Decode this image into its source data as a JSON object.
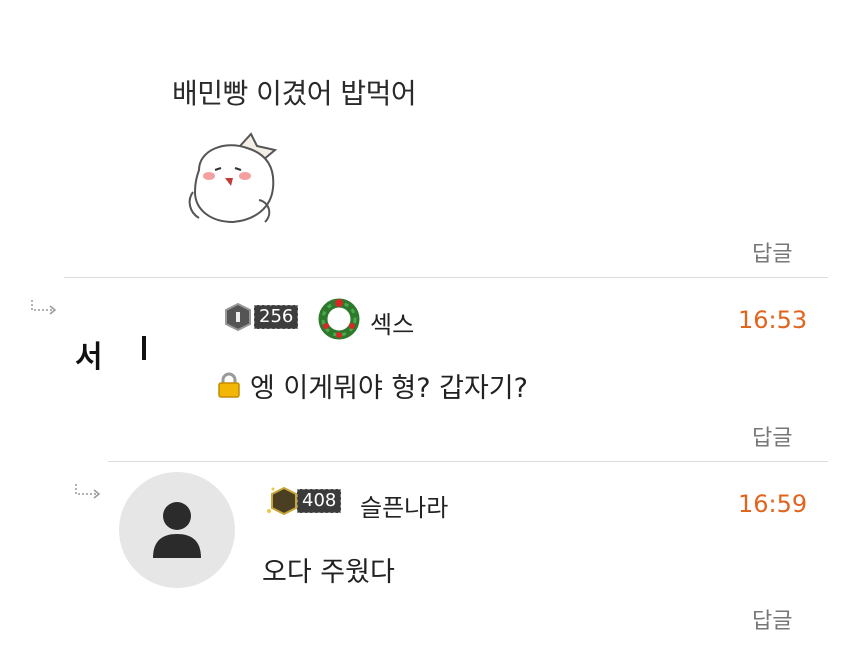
{
  "comment1": {
    "text": "배민빵 이겼어 밥먹어",
    "emoticon": "bread-character-emoticon",
    "reply_label": "답글"
  },
  "comment2": {
    "left_char": "서",
    "level": "256",
    "nickname": "섹스",
    "time": "16:53",
    "message": "엥 이게뭐야 형? 갑자기?",
    "lock_icon": "lock-icon",
    "reply_label": "답글"
  },
  "comment3": {
    "level": "408",
    "nickname": "슬픈나라",
    "time": "16:59",
    "message": "오다 주웠다",
    "reply_label": "답글"
  },
  "colors": {
    "time": "#e0651e",
    "divider": "#dcdcdc",
    "avatar_bg": "#e6e6e6"
  }
}
